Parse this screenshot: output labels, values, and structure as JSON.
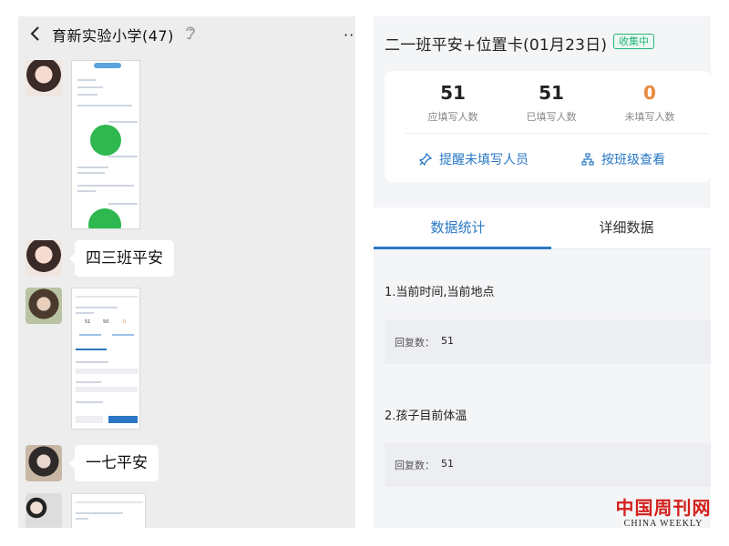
{
  "chat": {
    "title": "育新实验小学(47)",
    "more": "··",
    "messages": [
      {
        "type": "image",
        "sender": "avatar-a"
      },
      {
        "type": "text",
        "sender": "avatar-a",
        "text": "四三班平安"
      },
      {
        "type": "image",
        "sender": "avatar-b"
      },
      {
        "type": "text",
        "sender": "avatar-c",
        "text": "一七平安"
      },
      {
        "type": "image",
        "sender": "avatar-d"
      }
    ]
  },
  "form": {
    "title": "二一班平安+位置卡(01月23日)",
    "status": "收集中",
    "stats": [
      {
        "value": "51",
        "label": "应填写人数",
        "color": "#222222"
      },
      {
        "value": "51",
        "label": "已填写人数",
        "color": "#222222"
      },
      {
        "value": "0",
        "label": "未填写人数",
        "color": "#e98a3f"
      }
    ],
    "actions": {
      "remind": "提醒未填写人员",
      "by_class": "按班级查看"
    },
    "tabs": [
      {
        "label": "数据统计",
        "active": true
      },
      {
        "label": "详细数据",
        "active": false
      }
    ],
    "questions": [
      {
        "title": "1.当前时间,当前地点",
        "reply_label": "回复数：",
        "reply_count": "51"
      },
      {
        "title": "2.孩子目前体温",
        "reply_label": "回复数：",
        "reply_count": "51"
      }
    ]
  },
  "watermark": {
    "cn": "中国周刊网",
    "en": "CHINA WEEKLY"
  },
  "colors": {
    "accent": "#2a78c5",
    "status_green": "#27b47b",
    "warning_orange": "#e98a3f",
    "watermark_red": "#d2201c"
  }
}
